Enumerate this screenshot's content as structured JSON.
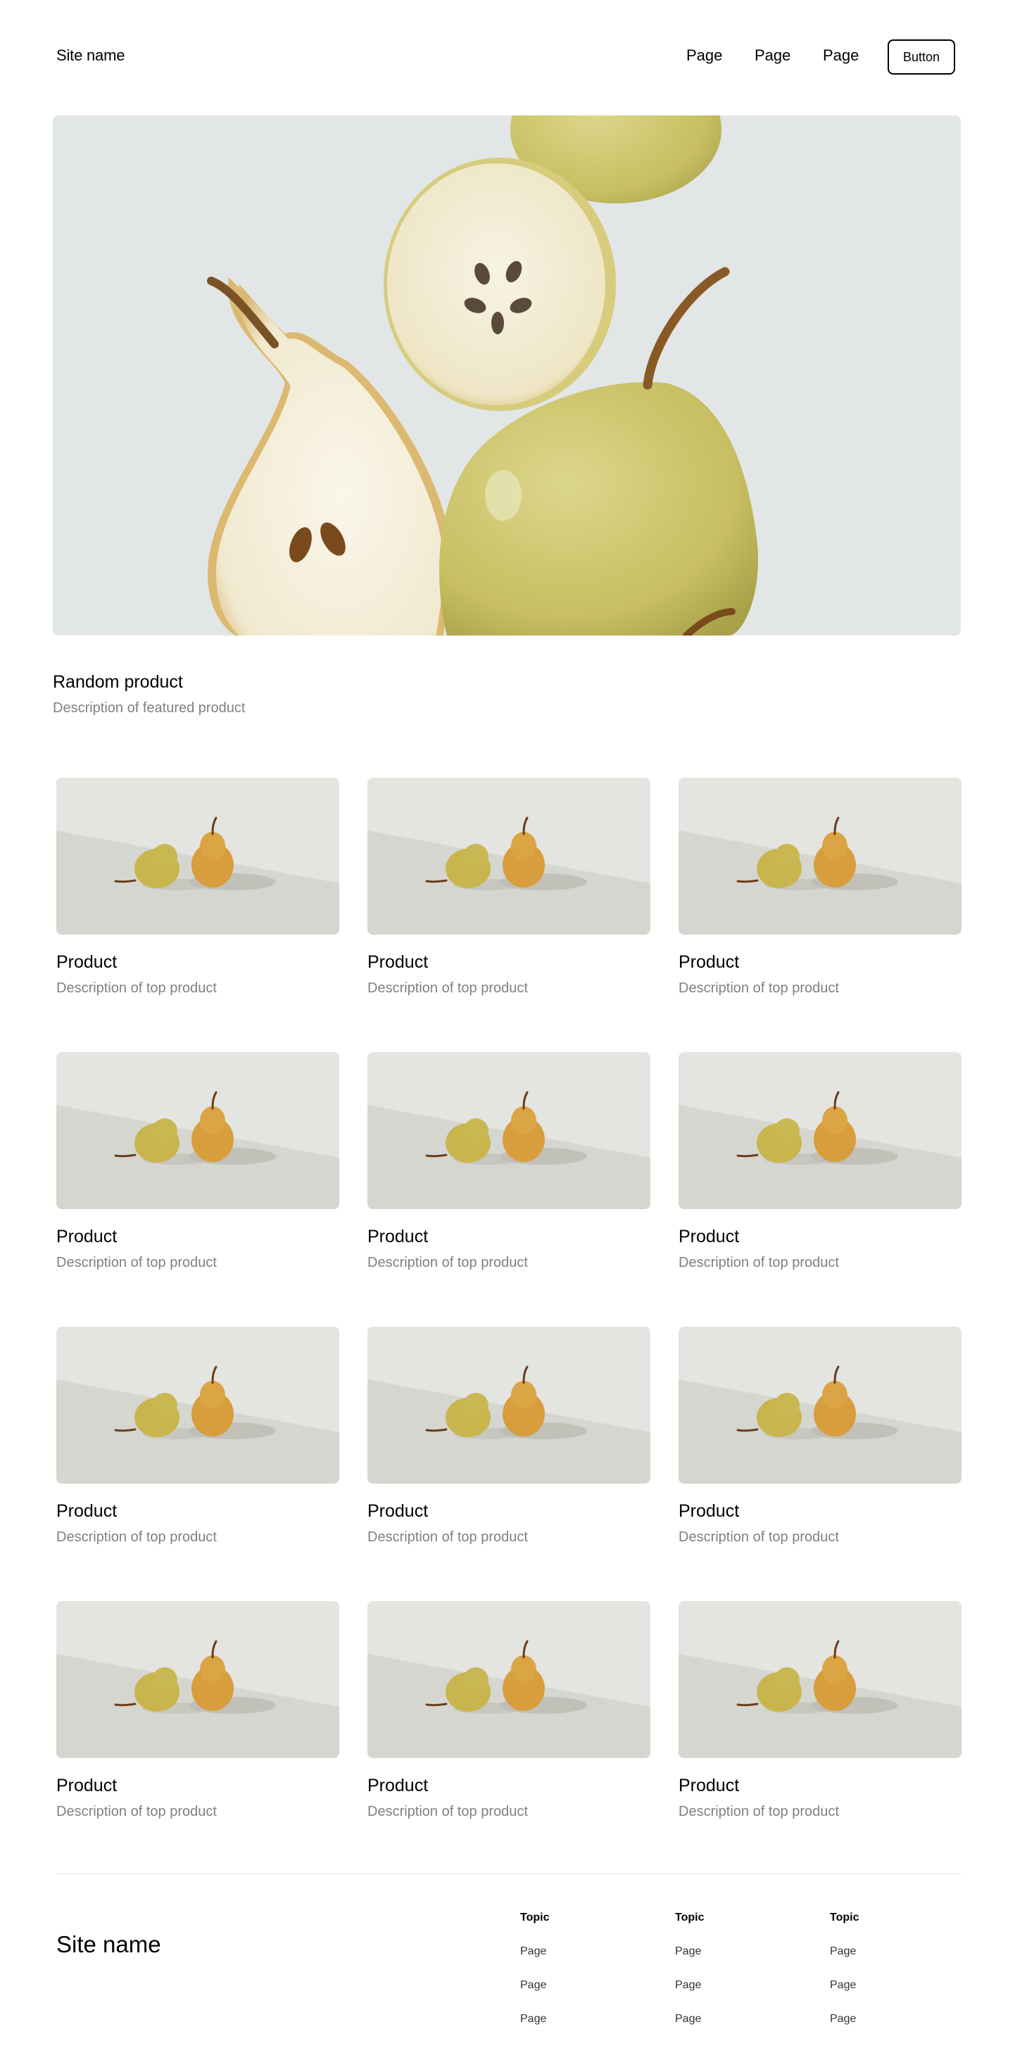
{
  "header": {
    "site_name": "Site name",
    "nav": [
      "Page",
      "Page",
      "Page"
    ],
    "button_label": "Button"
  },
  "featured": {
    "title": "Random product",
    "description": "Description of featured product"
  },
  "products": [
    {
      "title": "Product",
      "description": "Description of top product"
    },
    {
      "title": "Product",
      "description": "Description of top product"
    },
    {
      "title": "Product",
      "description": "Description of top product"
    },
    {
      "title": "Product",
      "description": "Description of top product"
    },
    {
      "title": "Product",
      "description": "Description of top product"
    },
    {
      "title": "Product",
      "description": "Description of top product"
    },
    {
      "title": "Product",
      "description": "Description of top product"
    },
    {
      "title": "Product",
      "description": "Description of top product"
    },
    {
      "title": "Product",
      "description": "Description of top product"
    },
    {
      "title": "Product",
      "description": "Description of top product"
    },
    {
      "title": "Product",
      "description": "Description of top product"
    },
    {
      "title": "Product",
      "description": "Description of top product"
    }
  ],
  "footer": {
    "site_name": "Site name",
    "columns": [
      {
        "topic": "Topic",
        "links": [
          "Page",
          "Page",
          "Page"
        ]
      },
      {
        "topic": "Topic",
        "links": [
          "Page",
          "Page",
          "Page"
        ]
      },
      {
        "topic": "Topic",
        "links": [
          "Page",
          "Page",
          "Page"
        ]
      }
    ]
  },
  "colors": {
    "text": "#000000",
    "muted": "#808080",
    "divider": "#e6e6e6",
    "hero_bg": "#e3e6e6",
    "pear_green": "#cfc56a",
    "pear_orange": "#d9a449"
  }
}
